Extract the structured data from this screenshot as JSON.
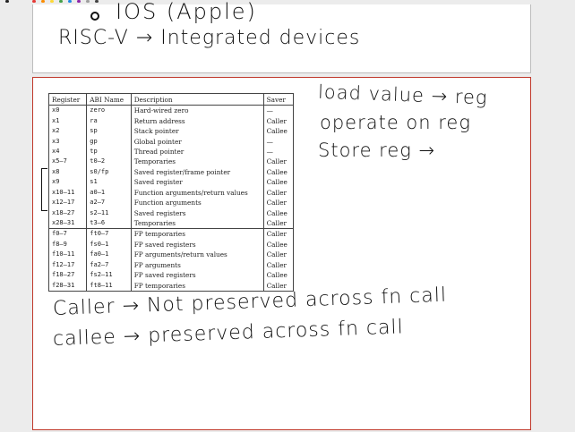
{
  "top_notes": {
    "line1": "IOS (Apple)",
    "line2": "RISC-V → Integrated devices"
  },
  "table": {
    "headers": [
      "Register",
      "ABI Name",
      "Description",
      "Saver"
    ],
    "rows": [
      [
        "x0",
        "zero",
        "Hard-wired zero",
        "—"
      ],
      [
        "x1",
        "ra",
        "Return address",
        "Caller"
      ],
      [
        "x2",
        "sp",
        "Stack pointer",
        "Callee"
      ],
      [
        "x3",
        "gp",
        "Global pointer",
        "—"
      ],
      [
        "x4",
        "tp",
        "Thread pointer",
        "—"
      ],
      [
        "x5–7",
        "t0–2",
        "Temporaries",
        "Caller"
      ],
      [
        "x8",
        "s0/fp",
        "Saved register/frame pointer",
        "Callee"
      ],
      [
        "x9",
        "s1",
        "Saved register",
        "Callee"
      ],
      [
        "x10–11",
        "a0–1",
        "Function arguments/return values",
        "Caller"
      ],
      [
        "x12–17",
        "a2–7",
        "Function arguments",
        "Caller"
      ],
      [
        "x18–27",
        "s2–11",
        "Saved registers",
        "Callee"
      ],
      [
        "x28–31",
        "t3–6",
        "Temporaries",
        "Caller"
      ],
      [
        "f0–7",
        "ft0–7",
        "FP temporaries",
        "Caller"
      ],
      [
        "f8–9",
        "fs0–1",
        "FP saved registers",
        "Callee"
      ],
      [
        "f10–11",
        "fa0–1",
        "FP arguments/return values",
        "Caller"
      ],
      [
        "f12–17",
        "fa2–7",
        "FP arguments",
        "Caller"
      ],
      [
        "f18–27",
        "fs2–11",
        "FP saved registers",
        "Callee"
      ],
      [
        "f28–31",
        "ft8–11",
        "FP temporaries",
        "Caller"
      ]
    ]
  },
  "side_notes": [
    "load value → reg",
    "operate on reg",
    "Store reg →"
  ],
  "bottom_notes": [
    "Caller → Not preserved across fn call",
    "callee → preserved across fn call"
  ]
}
